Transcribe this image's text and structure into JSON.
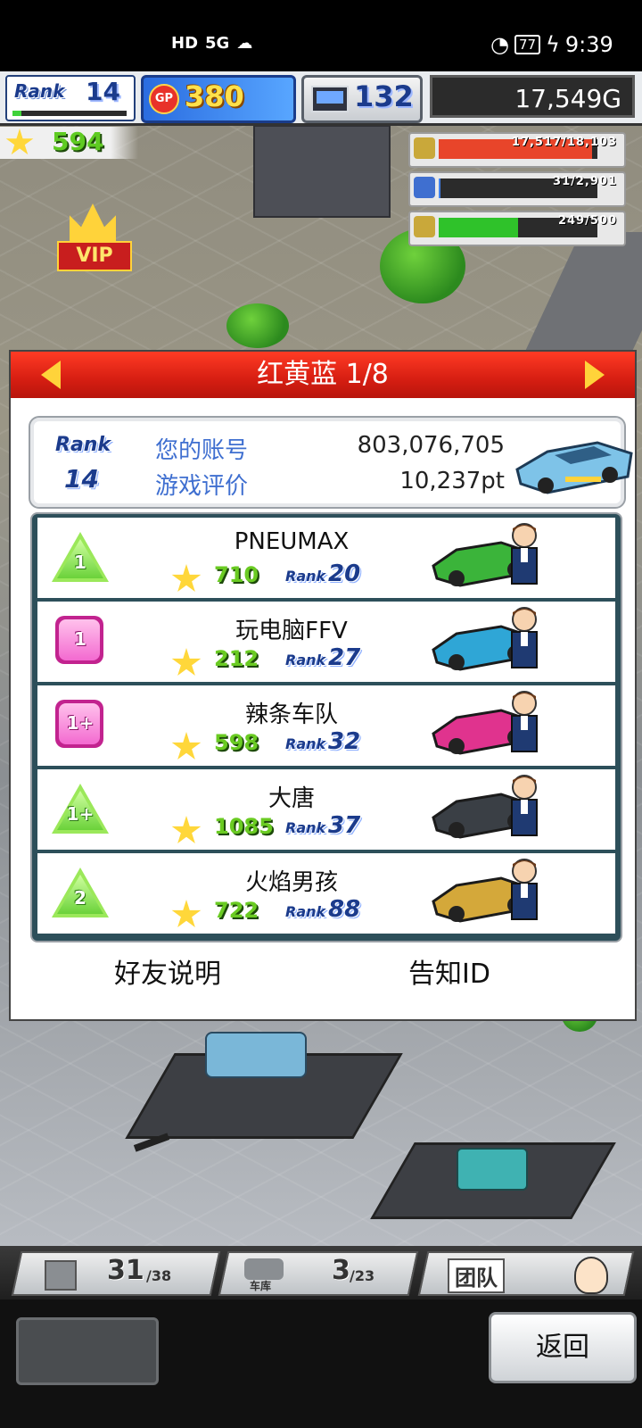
{
  "status_bar": {
    "network_left": "HD",
    "signal": "5G",
    "battery": "77",
    "time": "9:39"
  },
  "hud": {
    "rank_label": "Rank",
    "rank_value": "14",
    "rank_progress_percent": 8,
    "gp_icon_text": "GP",
    "gp_value": "380",
    "pc_value": "132",
    "money": "17,549G",
    "stars_value": "594",
    "vip_label": "VIP",
    "resources": [
      {
        "name": "coins",
        "text": "17,517/18,103",
        "fill_percent": 96.8,
        "color": "#e8452a",
        "icon_color": "#c9a83a"
      },
      {
        "name": "fuel",
        "text": "31/2,901",
        "fill_percent": 1.1,
        "color": "#3f7fe8",
        "icon_color": "#3f6fd0"
      },
      {
        "name": "research",
        "text": "249/500",
        "fill_percent": 49.8,
        "color": "#2fc22a",
        "icon_color": "#c9a83a"
      }
    ]
  },
  "dialog": {
    "title": "红黄蓝 1/8",
    "me": {
      "rank_label": "Rank",
      "rank_value": "14",
      "account_label": "您的账号",
      "account_value": "803,076,705",
      "rating_label": "游戏评价",
      "rating_value": "10,237pt"
    },
    "friends": [
      {
        "name": "PNEUMAX",
        "badge": "1",
        "badge_shape": "triangle",
        "stars": "710",
        "rank_label": "Rank",
        "rank": "20",
        "car_color": "#3bb43a"
      },
      {
        "name": "玩电脑FFV",
        "badge": "1",
        "badge_shape": "square",
        "stars": "212",
        "rank_label": "Rank",
        "rank": "27",
        "car_color": "#2fa6d6"
      },
      {
        "name": "辣条车队",
        "badge": "1+",
        "badge_shape": "square",
        "stars": "598",
        "rank_label": "Rank",
        "rank": "32",
        "car_color": "#e0338e"
      },
      {
        "name": "大唐",
        "badge": "1+",
        "badge_shape": "triangle",
        "stars": "1085",
        "rank_label": "Rank",
        "rank": "37",
        "car_color": "#3a3f45"
      },
      {
        "name": "火焰男孩",
        "badge": "2",
        "badge_shape": "triangle",
        "stars": "722",
        "rank_label": "Rank",
        "rank": "88",
        "car_color": "#d4a83a"
      }
    ],
    "footer": {
      "friend_help": "好友说明",
      "notify_id": "告知ID"
    }
  },
  "bottom_tabs": {
    "tab1_value": "31",
    "tab1_max": "38",
    "tab2_label": "车库",
    "tab2_value": "3",
    "tab2_max": "23",
    "tab3_label": "团队"
  },
  "bottom": {
    "back_label": "返回"
  }
}
